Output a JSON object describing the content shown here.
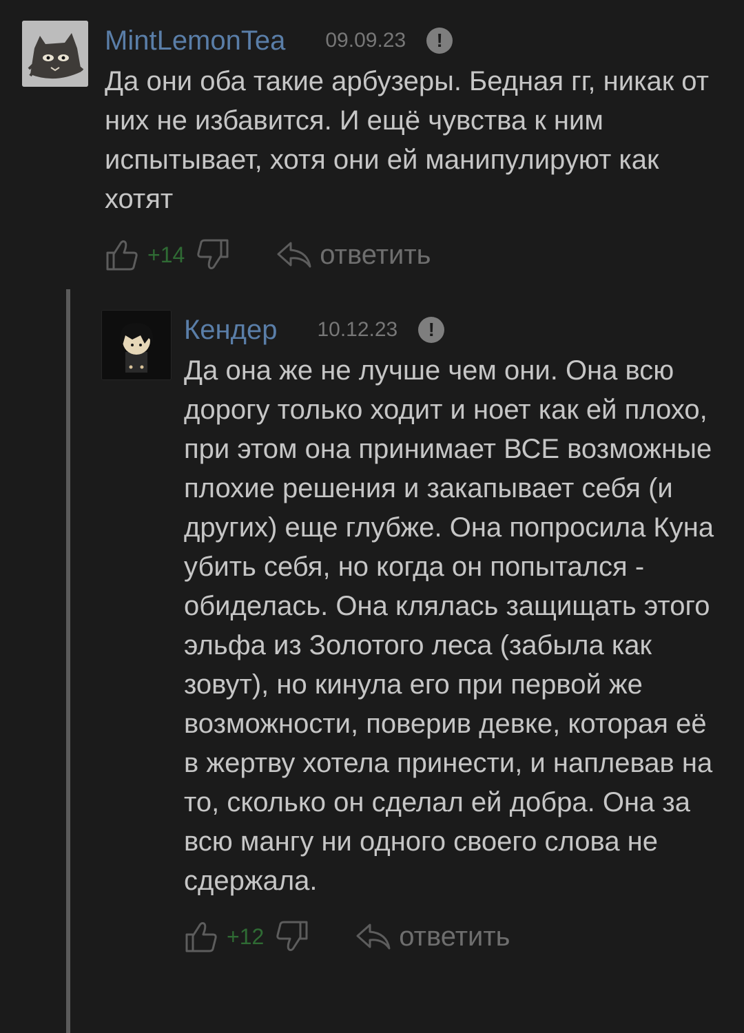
{
  "comments": [
    {
      "author": "MintLemonTea",
      "date": "09.09.23",
      "text": "Да они оба такие арбузеры. Бедная гг, никак от них не избавится. И ещё чувства к ним испытывает, хотя они ей манипулируют как хотят",
      "score": "+14",
      "reply_label": "ответить"
    },
    {
      "author": "Кендер",
      "date": "10.12.23",
      "text": "Да она же не лучше чем они. Она всю дорогу только ходит и ноет как ей плохо, при этом она принимает ВСЕ возможные плохие решения и закапывает себя (и других) еще глубже. Она попросила Куна убить себя, но когда он попытался - обиделась. Она клялась защищать этого эльфа из Золотого леса (забыла как зовут), но кинула его при первой же возможности, поверив девке, которая её в жертву хотела принести, и наплевав на то, сколько он сделал ей добра. Она за всю мангу ни одного своего слова не сдержала.",
      "score": "+12",
      "reply_label": "ответить"
    }
  ],
  "colors": {
    "background": "#1b1b1b",
    "author": "#5a7ea8",
    "score_positive": "#2f6b34",
    "thread_line": "#5b5b5b"
  },
  "icons": [
    "avatar",
    "report-icon",
    "thumbs-up-icon",
    "thumbs-down-icon",
    "reply-arrow-icon"
  ]
}
